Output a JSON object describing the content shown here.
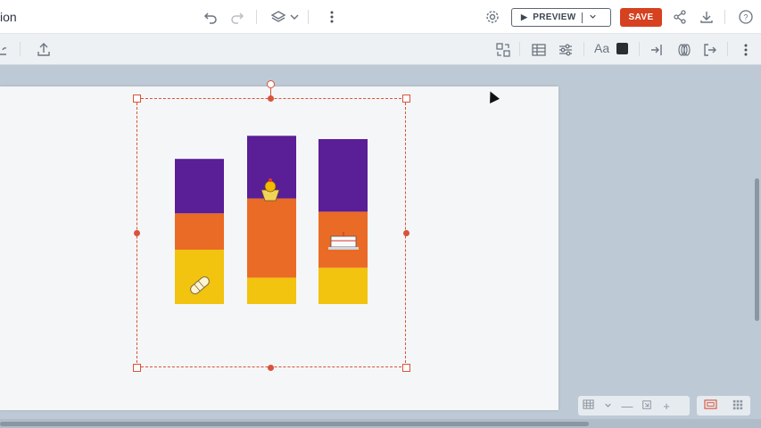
{
  "app": {
    "title": "ion"
  },
  "topbar": {
    "preview_label": "PREVIEW",
    "save_label": "SAVE",
    "icons": [
      "undo-icon",
      "redo-icon",
      "layers-icon",
      "chevron-down-icon",
      "more-vertical-icon",
      "settings-icon",
      "share-icon",
      "download-icon",
      "help-icon"
    ]
  },
  "toolbar2": {
    "font_label": "Aa",
    "text_color": "#2a2d31",
    "icons": [
      "library-icon",
      "upload-icon",
      "replace-icon",
      "table-icon",
      "adjust-icon",
      "font-icon",
      "color-icon",
      "enter-icon",
      "animation-icon",
      "exit-icon",
      "more-vertical-icon"
    ]
  },
  "colors": {
    "save": "#d6411f",
    "selection": "#d9533b",
    "purple": "#5a1e96",
    "orange": "#ea6b25",
    "yellow": "#f2c30f"
  },
  "chart_data": {
    "type": "bar",
    "stacked": true,
    "categories": [
      "",
      "",
      ""
    ],
    "series": [
      {
        "color": "#f2c30f",
        "values": [
          0.33,
          0.16,
          0.22
        ]
      },
      {
        "color": "#ea6b25",
        "values": [
          0.22,
          0.48,
          0.34
        ]
      },
      {
        "color": "#5a1e96",
        "values": [
          0.33,
          0.38,
          0.44
        ]
      }
    ],
    "icons": [
      "burrito-icon",
      "cupcake-icon",
      "cake-icon"
    ],
    "grid": false,
    "legend": "none"
  },
  "zoom_controls": {
    "icons": [
      "grid-view-icon",
      "zoom-out-icon",
      "fit-icon",
      "zoom-in-icon"
    ]
  },
  "view_controls": {
    "icons": [
      "single-view-icon",
      "multi-view-icon"
    ]
  }
}
